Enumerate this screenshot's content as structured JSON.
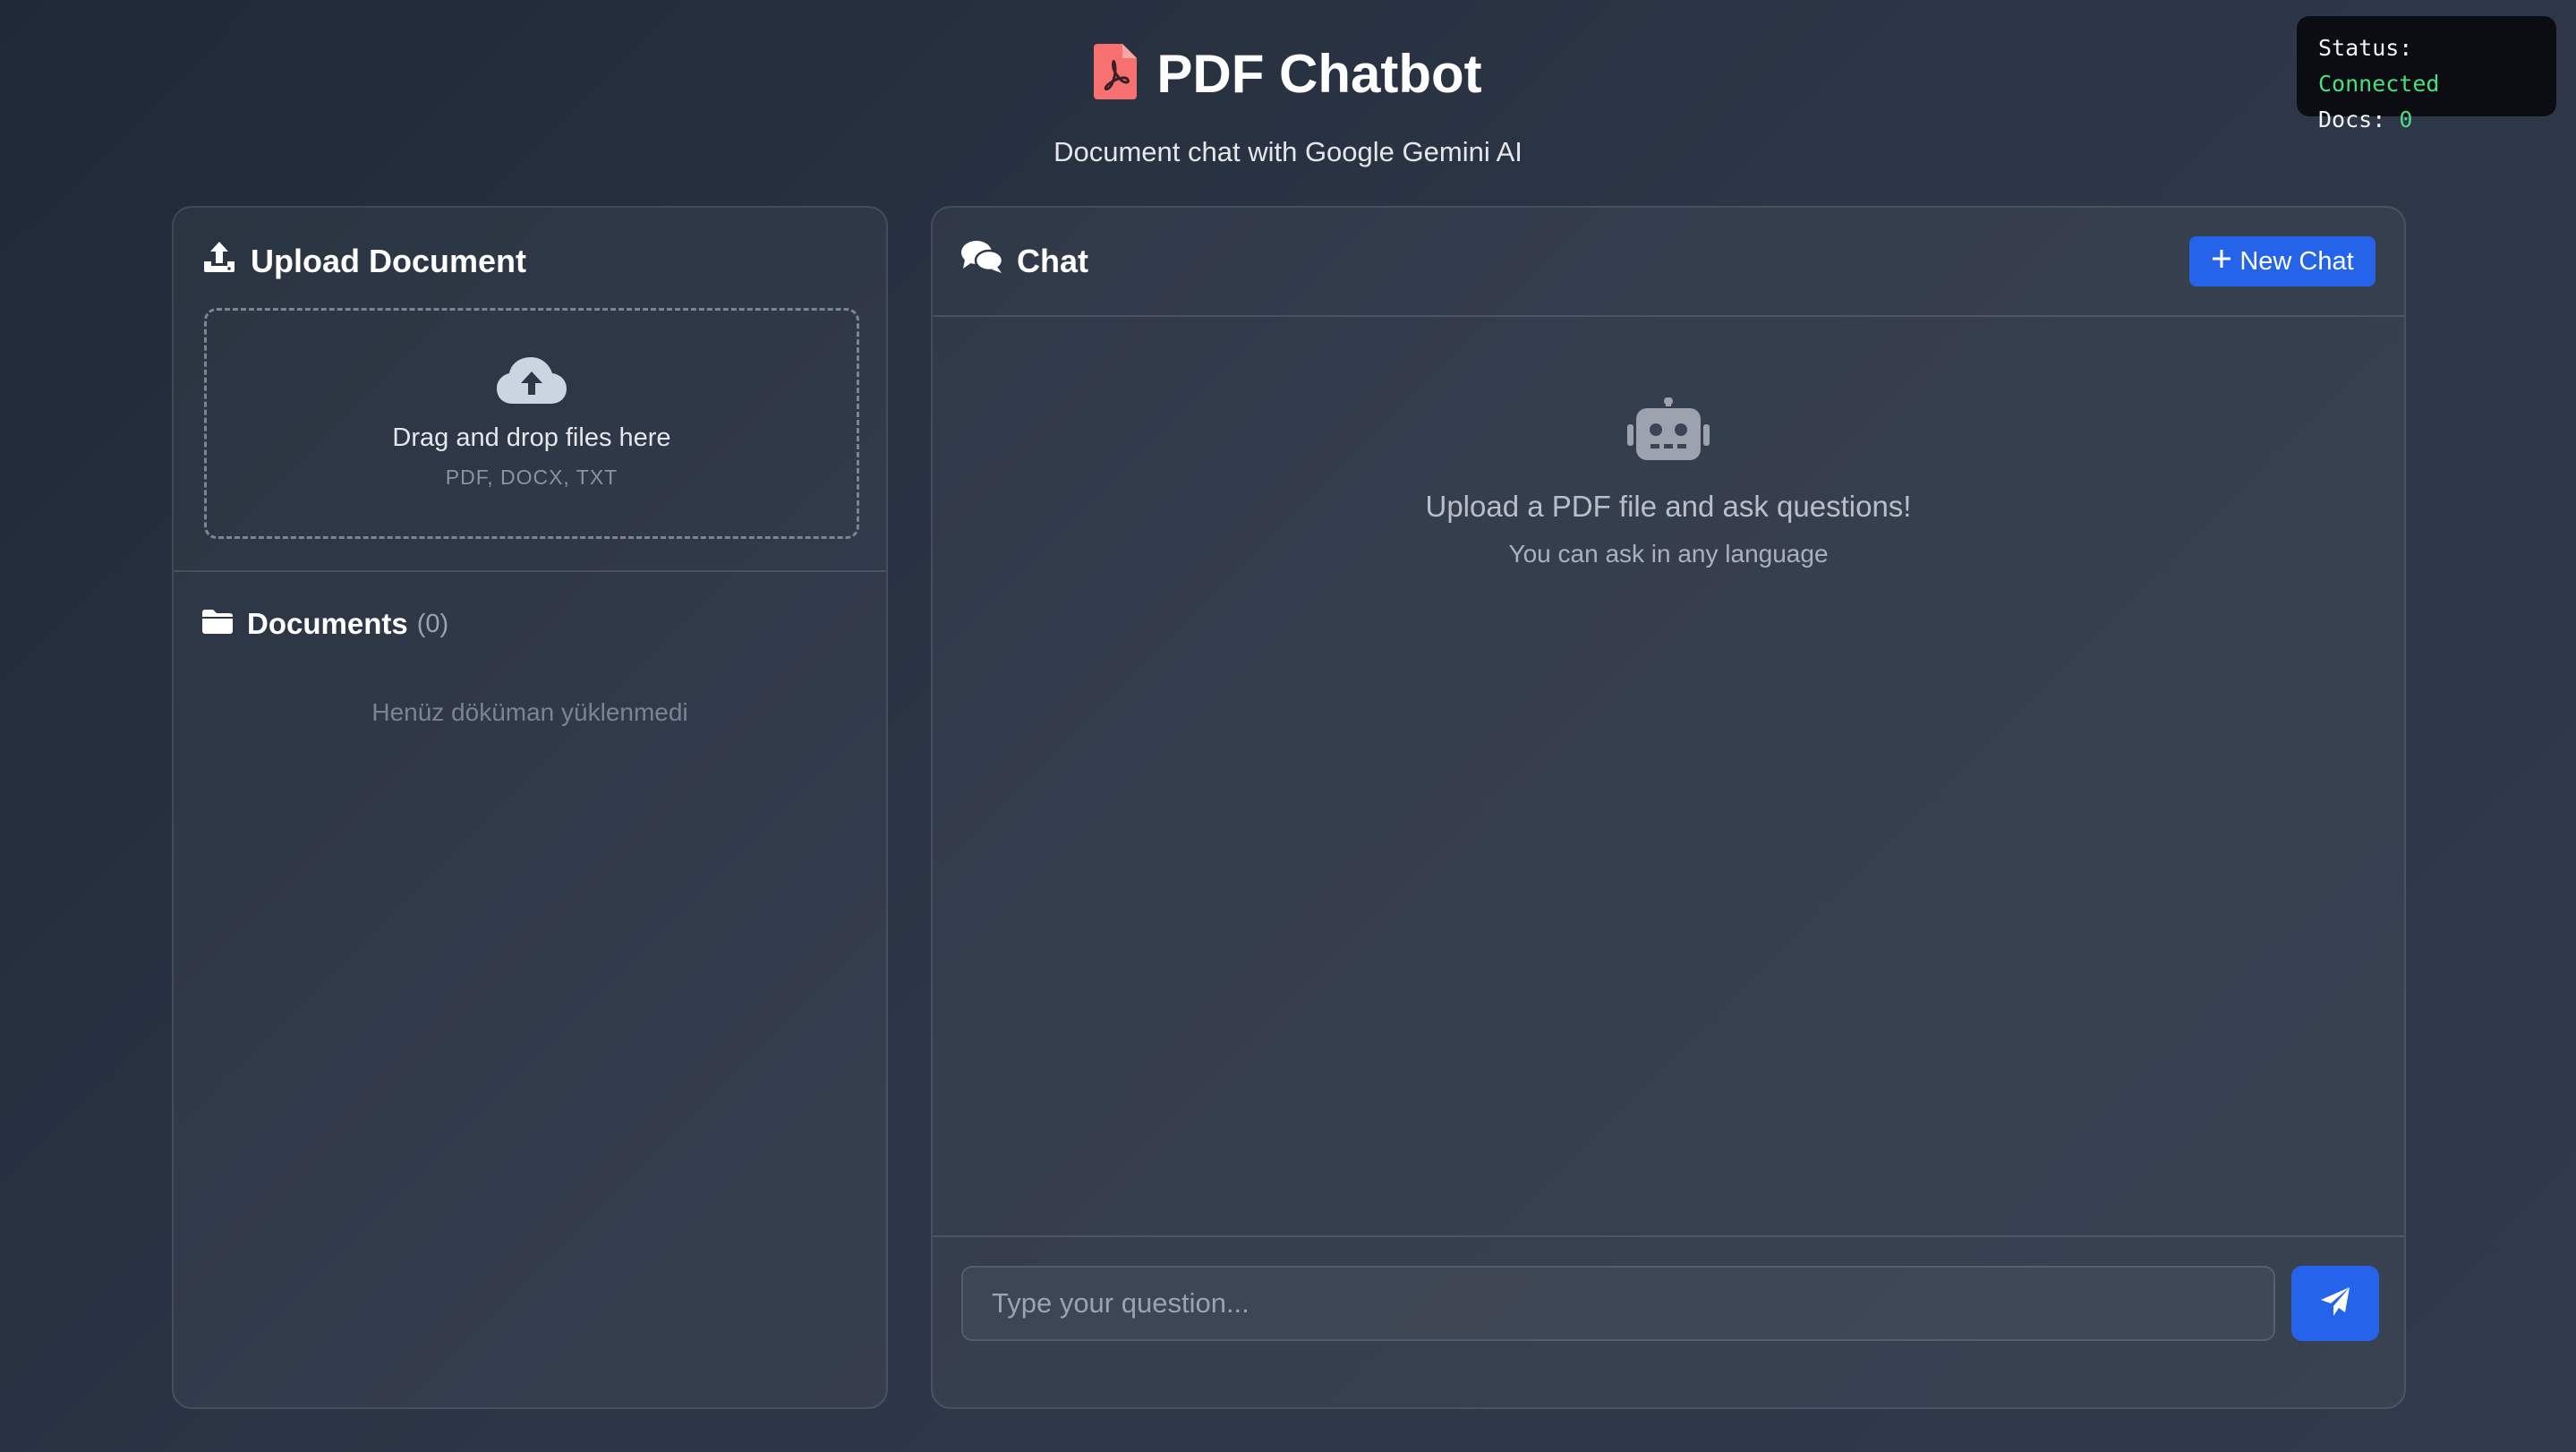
{
  "header": {
    "app_title": "PDF Chatbot",
    "subtitle": "Document chat with Google Gemini AI",
    "logo_icon": "pdf-file-icon",
    "logo_color": "#f87171"
  },
  "status": {
    "status_label": "Status:",
    "status_value": "Connected",
    "docs_label": "Docs:",
    "docs_value": "0",
    "value_color": "#4ade80"
  },
  "upload": {
    "title": "Upload Document",
    "icon": "upload-icon",
    "dropzone_icon": "cloud-upload-icon",
    "dropzone_text": "Drag and drop files here",
    "dropzone_types": "PDF, DOCX, TXT"
  },
  "documents": {
    "title": "Documents",
    "count": "(0)",
    "icon": "folder-icon",
    "empty_text": "Henüz döküman yüklenmedi"
  },
  "chat": {
    "title": "Chat",
    "icon": "comments-icon",
    "new_chat_label": "New Chat",
    "welcome_icon": "robot-icon",
    "welcome_title": "Upload a PDF file and ask questions!",
    "welcome_subtitle": "You can ask in any language",
    "input_placeholder": "Type your question...",
    "input_value": "",
    "send_icon": "paper-plane-icon",
    "accent_color": "#2563eb"
  }
}
